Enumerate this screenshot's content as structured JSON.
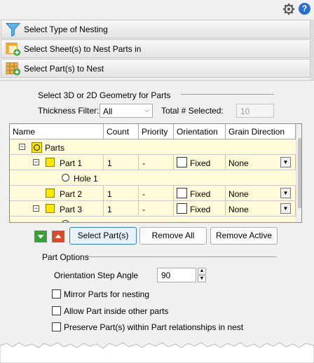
{
  "topbar": {
    "help_glyph": "?"
  },
  "sections": [
    {
      "label": "Select Type of Nesting",
      "icon": "funnel-icon"
    },
    {
      "label": "Select Sheet(s) to Nest Parts in",
      "icon": "sheet-add-icon"
    },
    {
      "label": "Select Part(s) to Nest",
      "icon": "parts-grid-add-icon"
    }
  ],
  "geometry": {
    "heading": "Select 3D or 2D Geometry for Parts",
    "thickness_label": "Thickness Filter:",
    "thickness_value": "All",
    "total_label": "Total # Selected:",
    "total_value": "10"
  },
  "grid": {
    "columns": [
      "Name",
      "Count",
      "Priority",
      "Orientation",
      "Grain Direction"
    ],
    "rows": [
      {
        "name": "Parts",
        "type": "root",
        "count": "",
        "priority": "",
        "orientation": "",
        "grain": ""
      },
      {
        "name": "Part 1",
        "type": "part",
        "count": "1",
        "priority": "-",
        "orientation": "Fixed",
        "grain": "None"
      },
      {
        "name": "Hole 1",
        "type": "hole",
        "count": "",
        "priority": "",
        "orientation": "",
        "grain": ""
      },
      {
        "name": "Part 2",
        "type": "part",
        "count": "1",
        "priority": "-",
        "orientation": "Fixed",
        "grain": "None"
      },
      {
        "name": "Part 3",
        "type": "part",
        "count": "1",
        "priority": "-",
        "orientation": "Fixed",
        "grain": "None"
      }
    ]
  },
  "buttons": {
    "select_parts": "Select Part(s)",
    "remove_all": "Remove All",
    "remove_active": "Remove Active"
  },
  "part_options": {
    "heading": "Part Options",
    "step_angle_label": "Orientation Step Angle",
    "step_angle_value": "90",
    "mirror_label": "Mirror Parts for nesting",
    "allow_inside_label": "Allow Part inside other parts",
    "preserve_label": "Preserve Part(s) within Part relationships in nest"
  },
  "colors": {
    "row_highlight": "#fffbd8",
    "tree_line": "#1a1a80",
    "part_icon": "#ffe800",
    "move_down_green": "#3aa03a",
    "move_up_red": "#d84a2a"
  }
}
